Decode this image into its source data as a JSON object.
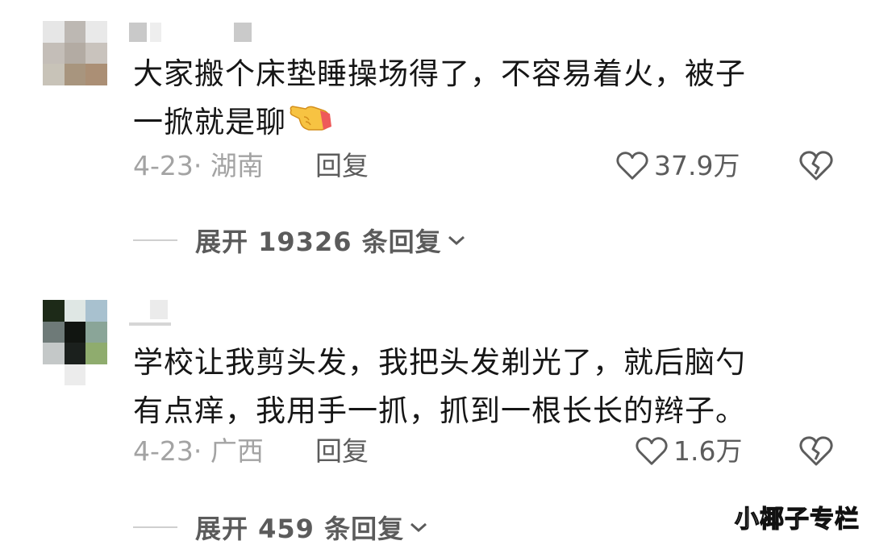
{
  "comments": [
    {
      "text_line1": "大家搬个床垫睡操场得了，不容易着火，被子",
      "text_line2": "一掀就是聊",
      "date": "4-23",
      "separator": "·",
      "location": "湖南",
      "reply_label": "回复",
      "like_count": "37.9万",
      "expand_label": "展开 19326 条回复",
      "emoji_icon": "pointing-hand-icon"
    },
    {
      "text_line1": "学校让我剪头发，我把头发剃光了，就后脑勺",
      "text_line2": "有点痒，我用手一抓，抓到一根长长的辫子。",
      "date": "4-23",
      "separator": "·",
      "location": "广西",
      "reply_label": "回复",
      "like_count": "1.6万",
      "expand_label": "展开 459 条回复"
    }
  ],
  "watermark": "小椰子专栏",
  "colors": {
    "text": "#161616",
    "meta": "#a3a3a3",
    "action": "#5c5c5c"
  }
}
